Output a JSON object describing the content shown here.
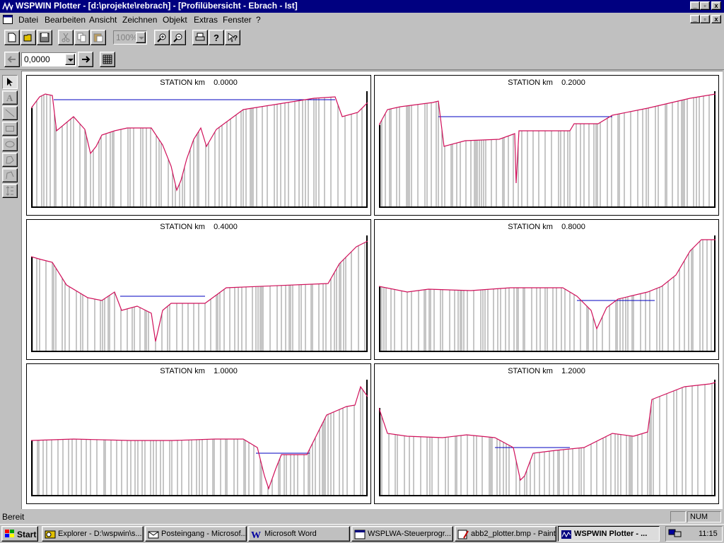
{
  "window": {
    "title": "WSPWIN Plotter - [d:\\projekte\\rebrach] - [Profilübersicht - Ebrach - Ist]",
    "controls": [
      "_",
      "▫",
      "x"
    ]
  },
  "menu": [
    {
      "label": "Datei"
    },
    {
      "label": "Bearbeiten"
    },
    {
      "label": "Ansicht"
    },
    {
      "label": "Zeichnen"
    },
    {
      "label": "Objekt"
    },
    {
      "label": "Extras"
    },
    {
      "label": "Fenster"
    },
    {
      "label": "?"
    }
  ],
  "toolbar": {
    "zoom_value": "100%",
    "buttons": [
      "new-icon",
      "open-icon",
      "save-icon",
      "cut-icon",
      "copy-icon",
      "paste-icon",
      "zoom-in-icon",
      "zoom-out-icon",
      "print-icon",
      "help-icon",
      "context-help-icon"
    ]
  },
  "station_bar": {
    "value": "0,0000"
  },
  "palette": [
    "pointer-icon",
    "text-icon",
    "line-icon",
    "rectangle-icon",
    "ellipse-icon",
    "polygon-icon",
    "polyline-icon",
    "dimension-icon"
  ],
  "profiles": [
    {
      "title": "STATION km    0.0000"
    },
    {
      "title": "STATION km    0.2000"
    },
    {
      "title": "STATION km    0.4000"
    },
    {
      "title": "STATION km    0.8000"
    },
    {
      "title": "STATION km    1.0000"
    },
    {
      "title": "STATION km    1.2000"
    }
  ],
  "colors": {
    "ground_line": "#d0105a",
    "water_level": "#0000c0",
    "vertical_lines": "#404040",
    "title_bar": "#000080"
  },
  "statusbar": {
    "ready": "Bereit",
    "num": "NUM"
  },
  "taskbar": {
    "start": "Start",
    "tasks": [
      {
        "label": "Explorer - D:\\wspwin\\s..."
      },
      {
        "label": "Posteingang - Microsof..."
      },
      {
        "label": "Microsoft Word"
      },
      {
        "label": "WSPLWA-Steuerprogr..."
      },
      {
        "label": "abb2_plotter.bmp - Paint"
      },
      {
        "label": "WSPWIN Plotter - ..."
      }
    ],
    "clock": "11:15"
  }
}
